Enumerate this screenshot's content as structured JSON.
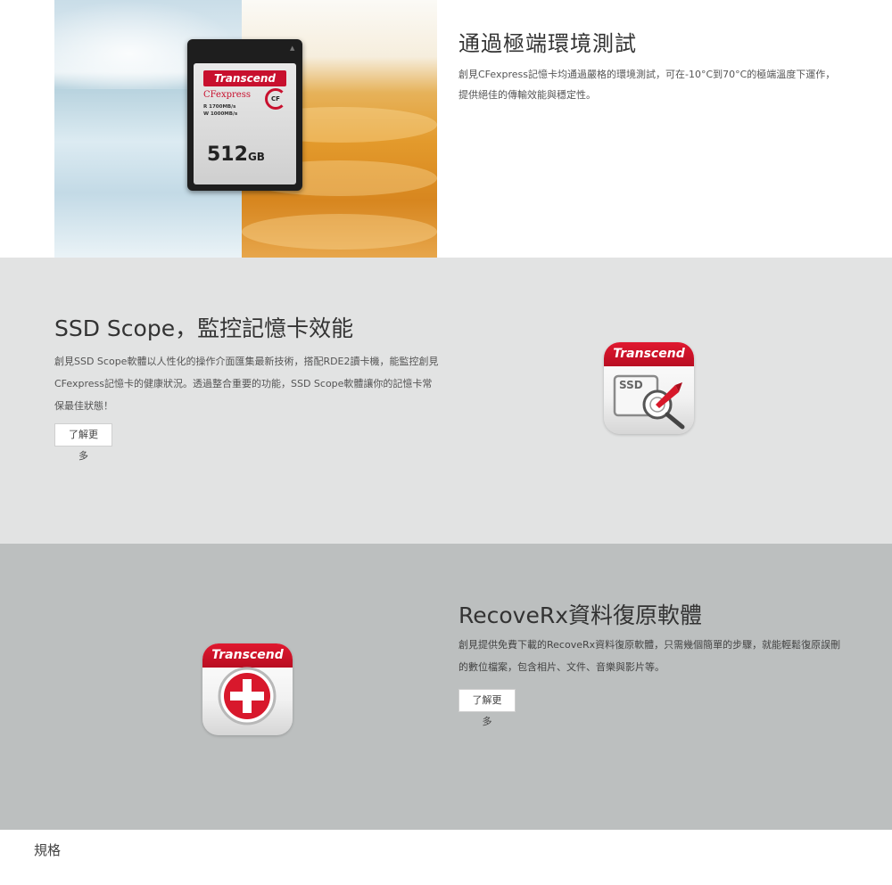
{
  "section_environment": {
    "title": "通過極端環境測試",
    "description": "創見CFexpress記憶卡均通過嚴格的環境測試，可在-10°C到70°C的極端溫度下運作，提供絕佳的傳輸效能與穩定性。",
    "card": {
      "brand": "Transcend",
      "type": "CFexpress",
      "read": "R 1700MB/s",
      "write": "W 1000MB/s",
      "cf_logo": "CF",
      "capacity": "512",
      "unit": "GB"
    }
  },
  "section_ssd_scope": {
    "title": "SSD Scope，監控記憶卡效能",
    "description": "創見SSD Scope軟體以人性化的操作介面匯集最新技術，搭配RDE2讀卡機，能監控創見CFexpress記憶卡的健康狀況。透過整合重要的功能，SSD Scope軟體讓你的記憶卡常保最佳狀態！",
    "learn_more": "了解更多",
    "icon_brand": "Transcend",
    "icon_label": "SSD"
  },
  "section_recoverx": {
    "title": "RecoveRx資料復原軟體",
    "description": "創見提供免費下載的RecoveRx資料復原軟體，只需幾個簡單的步驟，就能輕鬆復原誤刪的數位檔案，包含相片、文件、音樂與影片等。",
    "learn_more": "了解更多",
    "icon_brand": "Transcend"
  },
  "footer": {
    "spec_label": "規格"
  },
  "colors": {
    "brand_red": "#c8102e",
    "section2_bg": "#e2e3e3",
    "section3_bg": "#bcbfbf"
  }
}
